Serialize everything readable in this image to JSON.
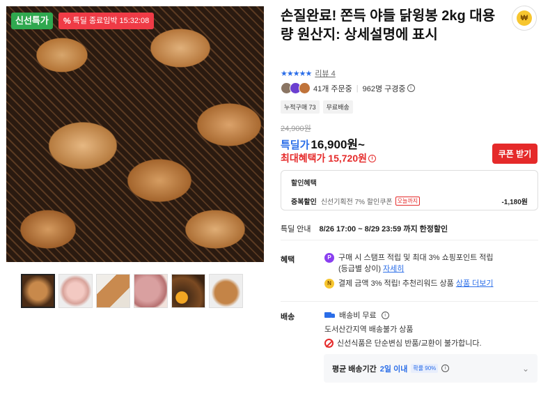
{
  "image": {
    "badge_fresh": "신선특가",
    "badge_deadline_icon": "%",
    "badge_deadline_text": "특딜 종료임박",
    "badge_deadline_time": "15:32:08",
    "thumbnails_count": 6
  },
  "product": {
    "title": "손질완료! 쫀득 야들 닭윙봉 2kg 대용량 원산지: 상세설명에 표시",
    "rating_stars": "★★★★★",
    "review_link": "리뷰 4",
    "order_count": "41개 주문중",
    "considering_count": "962명 구경중",
    "tags": [
      "누적구매 73",
      "무료배송"
    ]
  },
  "price": {
    "original": "24,900원",
    "sale_label": "특딜가",
    "sale_price": "16,900원~",
    "max_benefit": "최대혜택가 15,720원",
    "coupon_button": "쿠폰 받기"
  },
  "discount": {
    "title": "할인혜택",
    "line_label": "중복할인",
    "line_text": "신선기획전 7% 할인쿠폰",
    "line_tag": "오늘까지",
    "line_amount": "-1,180원"
  },
  "deal": {
    "label": "특딜 안내",
    "text": "8/26 17:00 ~ 8/29 23:59 까지 한정할인"
  },
  "benefits": {
    "label": "혜택",
    "item1_icon": "P",
    "item1_text": "구매 시 스탬프 적립 및 최대 3% 쇼핑포인트 적립",
    "item1_sub": "(등급별 상이)",
    "item1_link": "자세히",
    "item2_icon": "N",
    "item2_text": "결제 금액 3% 적립! 추천리워드 상품",
    "item2_link": "상품 더보기"
  },
  "shipping": {
    "label": "배송",
    "fee": "배송비 무료",
    "region": "도서산간지역 배송불가 상품",
    "notice": "신선식품은 단순변심 반품/교환이 불가합니다.",
    "avg_label": "평균 배송기간",
    "avg_value": "2일 이내",
    "probability": "확률 90%",
    "chevron": "⌄"
  },
  "share_icon_glyph": "₩"
}
